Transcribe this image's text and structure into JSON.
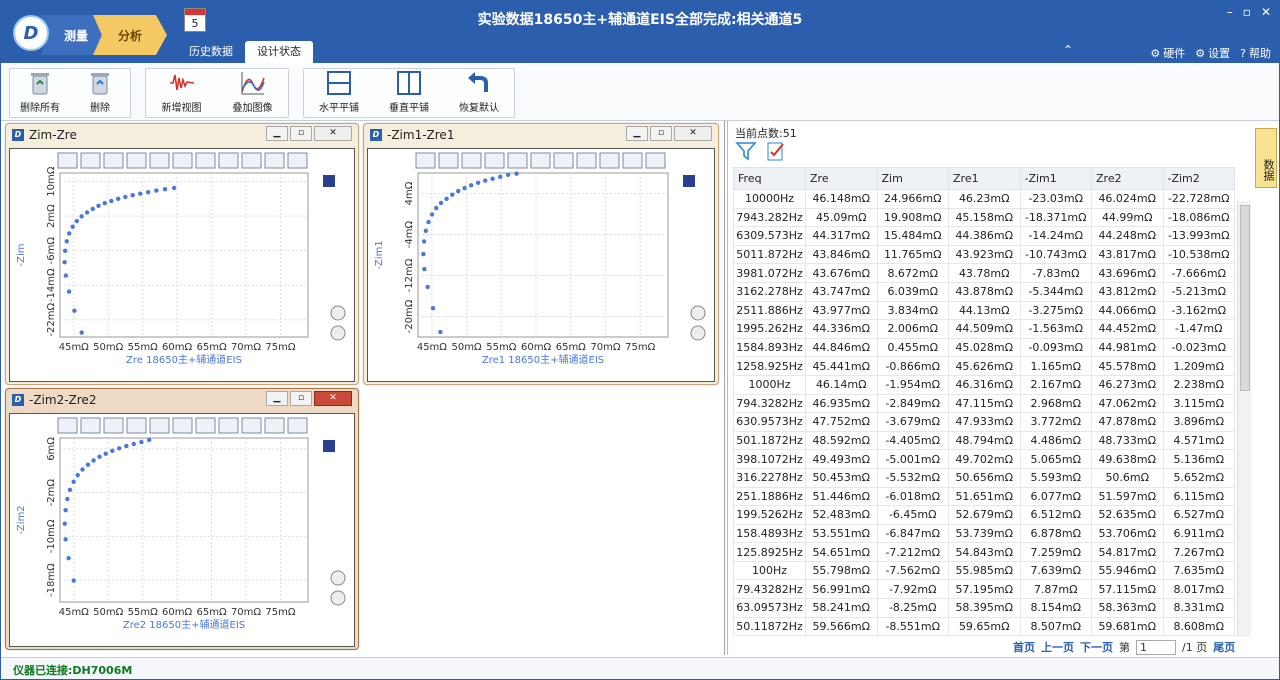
{
  "window": {
    "title": "实验数据18650主+辅通道EIS全部完成:相关通道5",
    "step_measure": "测量",
    "step_analyze": "分析",
    "calendar_day": "5",
    "tabs": [
      "历史数据",
      "设计状态"
    ],
    "links": {
      "hardware": "硬件",
      "settings": "设置",
      "help": "帮助"
    }
  },
  "ribbon": {
    "delete_all": "删除所有",
    "delete": "删除",
    "new_view": "新增视图",
    "overlay_image": "叠加图像",
    "tile_horizontal": "水平平铺",
    "tile_vertical": "垂直平铺",
    "restore_default": "恢复默认"
  },
  "charts": [
    {
      "title": "Zim-Zre",
      "ylabel": "-Zim",
      "xlabel": "Zre    18650主+辅通道EIS",
      "yticks": [
        "10mΩ",
        "2mΩ",
        "-6mΩ",
        "-14mΩ",
        "-22mΩ"
      ],
      "xticks": [
        "45mΩ",
        "50mΩ",
        "55mΩ",
        "60mΩ",
        "65mΩ",
        "70mΩ",
        "75mΩ"
      ]
    },
    {
      "title": "-Zim1-Zre1",
      "ylabel": "-Zim1",
      "xlabel": "Zre1    18650主+辅通道EIS",
      "yticks": [
        "4mΩ",
        "-4mΩ",
        "-12mΩ",
        "-20mΩ"
      ],
      "xticks": [
        "45mΩ",
        "50mΩ",
        "55mΩ",
        "60mΩ",
        "65mΩ",
        "70mΩ",
        "75mΩ"
      ]
    },
    {
      "title": "-Zim2-Zre2",
      "ylabel": "-Zim2",
      "xlabel": "Zre2    18650主+辅通道EIS",
      "yticks": [
        "6mΩ",
        "-2mΩ",
        "-10mΩ",
        "-18mΩ"
      ],
      "xticks": [
        "45mΩ",
        "50mΩ",
        "55mΩ",
        "60mΩ",
        "65mΩ",
        "70mΩ",
        "75mΩ"
      ]
    }
  ],
  "data_panel": {
    "count_label": "当前点数:51",
    "side_tab": "数据",
    "columns": [
      "Freq",
      "Zre",
      "Zim",
      "Zre1",
      "-Zim1",
      "Zre2",
      "-Zim2"
    ],
    "rows": [
      [
        "10000Hz",
        "46.148mΩ",
        "24.966mΩ",
        "46.23mΩ",
        "-23.03mΩ",
        "46.024mΩ",
        "-22.728mΩ"
      ],
      [
        "7943.282Hz",
        "45.09mΩ",
        "19.908mΩ",
        "45.158mΩ",
        "-18.371mΩ",
        "44.99mΩ",
        "-18.086mΩ"
      ],
      [
        "6309.573Hz",
        "44.317mΩ",
        "15.484mΩ",
        "44.386mΩ",
        "-14.24mΩ",
        "44.248mΩ",
        "-13.993mΩ"
      ],
      [
        "5011.872Hz",
        "43.846mΩ",
        "11.765mΩ",
        "43.923mΩ",
        "-10.743mΩ",
        "43.817mΩ",
        "-10.538mΩ"
      ],
      [
        "3981.072Hz",
        "43.676mΩ",
        "8.672mΩ",
        "43.78mΩ",
        "-7.83mΩ",
        "43.696mΩ",
        "-7.666mΩ"
      ],
      [
        "3162.278Hz",
        "43.747mΩ",
        "6.039mΩ",
        "43.878mΩ",
        "-5.344mΩ",
        "43.812mΩ",
        "-5.213mΩ"
      ],
      [
        "2511.886Hz",
        "43.977mΩ",
        "3.834mΩ",
        "44.13mΩ",
        "-3.275mΩ",
        "44.066mΩ",
        "-3.162mΩ"
      ],
      [
        "1995.262Hz",
        "44.336mΩ",
        "2.006mΩ",
        "44.509mΩ",
        "-1.563mΩ",
        "44.452mΩ",
        "-1.47mΩ"
      ],
      [
        "1584.893Hz",
        "44.846mΩ",
        "0.455mΩ",
        "45.028mΩ",
        "-0.093mΩ",
        "44.981mΩ",
        "-0.023mΩ"
      ],
      [
        "1258.925Hz",
        "45.441mΩ",
        "-0.866mΩ",
        "45.626mΩ",
        "1.165mΩ",
        "45.578mΩ",
        "1.209mΩ"
      ],
      [
        "1000Hz",
        "46.14mΩ",
        "-1.954mΩ",
        "46.316mΩ",
        "2.167mΩ",
        "46.273mΩ",
        "2.238mΩ"
      ],
      [
        "794.3282Hz",
        "46.935mΩ",
        "-2.849mΩ",
        "47.115mΩ",
        "2.968mΩ",
        "47.062mΩ",
        "3.115mΩ"
      ],
      [
        "630.9573Hz",
        "47.752mΩ",
        "-3.679mΩ",
        "47.933mΩ",
        "3.772mΩ",
        "47.878mΩ",
        "3.896mΩ"
      ],
      [
        "501.1872Hz",
        "48.592mΩ",
        "-4.405mΩ",
        "48.794mΩ",
        "4.486mΩ",
        "48.733mΩ",
        "4.571mΩ"
      ],
      [
        "398.1072Hz",
        "49.493mΩ",
        "-5.001mΩ",
        "49.702mΩ",
        "5.065mΩ",
        "49.638mΩ",
        "5.136mΩ"
      ],
      [
        "316.2278Hz",
        "50.453mΩ",
        "-5.532mΩ",
        "50.656mΩ",
        "5.593mΩ",
        "50.6mΩ",
        "5.652mΩ"
      ],
      [
        "251.1886Hz",
        "51.446mΩ",
        "-6.018mΩ",
        "51.651mΩ",
        "6.077mΩ",
        "51.597mΩ",
        "6.115mΩ"
      ],
      [
        "199.5262Hz",
        "52.483mΩ",
        "-6.45mΩ",
        "52.679mΩ",
        "6.512mΩ",
        "52.635mΩ",
        "6.527mΩ"
      ],
      [
        "158.4893Hz",
        "53.551mΩ",
        "-6.847mΩ",
        "53.739mΩ",
        "6.878mΩ",
        "53.706mΩ",
        "6.911mΩ"
      ],
      [
        "125.8925Hz",
        "54.651mΩ",
        "-7.212mΩ",
        "54.843mΩ",
        "7.259mΩ",
        "54.817mΩ",
        "7.267mΩ"
      ],
      [
        "100Hz",
        "55.798mΩ",
        "-7.562mΩ",
        "55.985mΩ",
        "7.639mΩ",
        "55.946mΩ",
        "7.635mΩ"
      ],
      [
        "79.43282Hz",
        "56.991mΩ",
        "-7.92mΩ",
        "57.195mΩ",
        "7.87mΩ",
        "57.115mΩ",
        "8.017mΩ"
      ],
      [
        "63.09573Hz",
        "58.241mΩ",
        "-8.25mΩ",
        "58.395mΩ",
        "8.154mΩ",
        "58.363mΩ",
        "8.331mΩ"
      ],
      [
        "50.11872Hz",
        "59.566mΩ",
        "-8.551mΩ",
        "59.65mΩ",
        "8.507mΩ",
        "59.681mΩ",
        "8.608mΩ"
      ]
    ],
    "pager": {
      "first": "首页",
      "prev": "上一页",
      "next": "下一页",
      "page_prefix": "第",
      "page_value": "1",
      "page_suffix": "/1 页",
      "last": "尾页"
    }
  },
  "status": {
    "connected": "仪器已连接:DH7006M"
  },
  "colors": {
    "accent": "#2b5fae",
    "points": "#4a78d6",
    "status_ok": "#0c7a1d"
  }
}
